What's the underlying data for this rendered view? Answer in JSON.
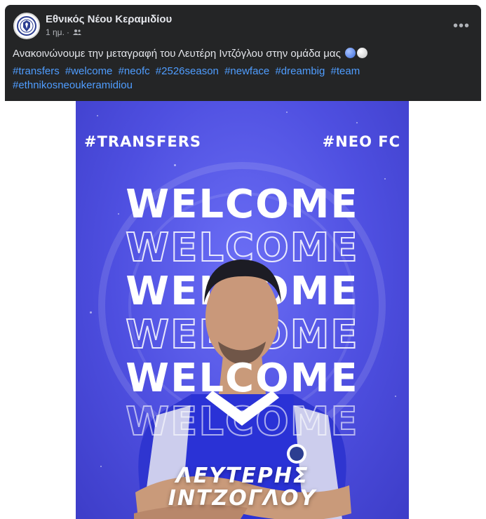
{
  "post": {
    "page_name": "Εθνικός Νέου Κεραμιδίου",
    "time": "1 ημ.",
    "separator": "·",
    "audience_icon": "friends-icon",
    "more_icon": "more-options-icon",
    "more_label": "•••",
    "text": "Ανακοινώνουμε την μεταγραφή του Λευτέρη Ιντζόγλου στην ομάδα μας",
    "emoji": [
      "blue-circle",
      "white-circle"
    ],
    "hashtags": [
      "#transfers",
      "#welcome",
      "#neofc",
      "#2526season",
      "#newface",
      "#dreambig",
      "#team",
      "#ethnikosneoukeramidiou"
    ]
  },
  "poster": {
    "tag_left": "#TRANSFERS",
    "tag_right": "#NEO FC",
    "welcome_word": "WELCOME",
    "name_line1": "ΛΕΥΤΕΡΗΣ",
    "name_line2": "ΙΝΤΖΟΓΛΟΥ"
  },
  "colors": {
    "card_bg": "#242526",
    "text_primary": "#e4e6eb",
    "text_secondary": "#b0b3b8",
    "hashtag": "#4f9dff",
    "poster_blue": "#4e4fe0"
  }
}
